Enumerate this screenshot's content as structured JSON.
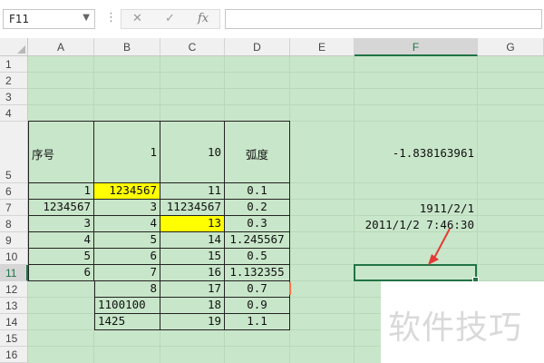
{
  "formula_bar": {
    "name_box": "F11",
    "dropdown_icon": "▼",
    "separator": "⋮",
    "cancel_icon": "✕",
    "confirm_icon": "✓",
    "fx_label": "fx",
    "formula_value": ""
  },
  "columns": [
    "A",
    "B",
    "C",
    "D",
    "E",
    "F",
    "G"
  ],
  "selected_column": "F",
  "rows": [
    "1",
    "2",
    "3",
    "4",
    "5",
    "6",
    "7",
    "8",
    "9",
    "10",
    "11",
    "12",
    "13",
    "14",
    "15",
    "16"
  ],
  "selected_row": "11",
  "table": {
    "header": {
      "a": "序号",
      "b": "1",
      "c": "10",
      "d": "弧度"
    },
    "rows": [
      {
        "a": "1",
        "b": "1234567",
        "c": "11",
        "d": "0.1"
      },
      {
        "a": "1234567",
        "b": "3",
        "c": "11234567",
        "d": "0.2"
      },
      {
        "a": "3",
        "b": "4",
        "c": "13",
        "d": "0.3"
      },
      {
        "a": "4",
        "b": "5",
        "c": "14",
        "d": "1.245567"
      },
      {
        "a": "5",
        "b": "6",
        "c": "15",
        "d": "0.5"
      },
      {
        "a": "6",
        "b": "7",
        "c": "16",
        "d": "1.132355"
      },
      {
        "a": "",
        "b": "8",
        "c": "17",
        "d": "0.7"
      },
      {
        "a": "",
        "b": "1100100",
        "c": "18",
        "d": "0.9"
      },
      {
        "a": "",
        "b": "1425",
        "c": "19",
        "d": "1.1"
      }
    ]
  },
  "column_f": {
    "f5": "-1.838163961",
    "f7": "1911/2/1",
    "f8": "2011/1/2  7:46:30"
  },
  "colors": {
    "grid_fill": "#c8e6c9",
    "highlight": "#ffff00",
    "selection": "#217346",
    "arrow": "#e53935"
  },
  "watermark": "软件技巧"
}
